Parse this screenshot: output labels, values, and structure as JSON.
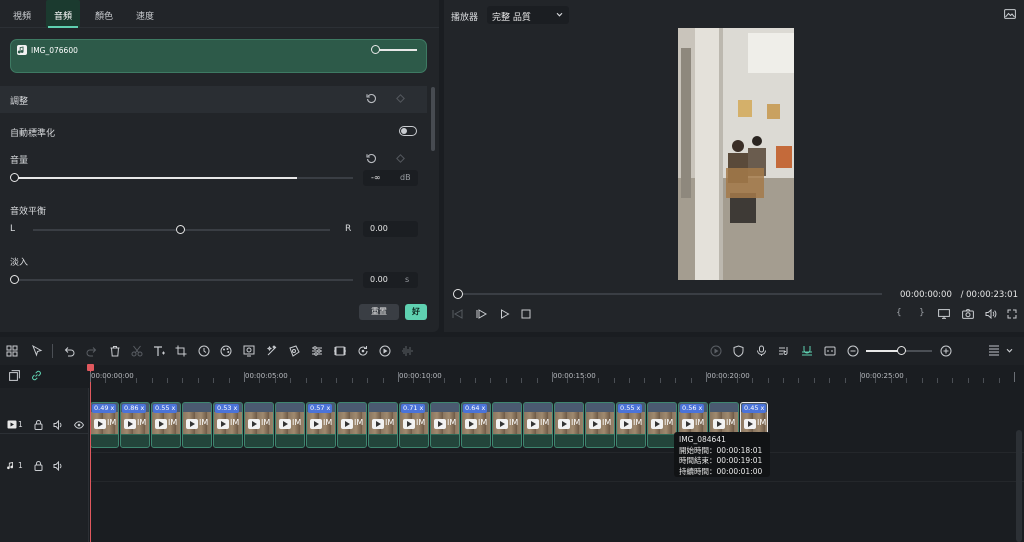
{
  "tabs": [
    "視頻",
    "音頻",
    "顏色",
    "速度"
  ],
  "active_tab": "音頻",
  "clip_name": "IMG_076600",
  "adjust_label": "調整",
  "auto_normalize_label": "自動標準化",
  "volume": {
    "label": "音量",
    "value": "-∞",
    "unit": "dB",
    "level": 0.0
  },
  "balance": {
    "label": "音效平衡",
    "left": "L",
    "right": "R",
    "value": "0.00"
  },
  "fade_in": {
    "label": "淡入",
    "value": "0.00",
    "unit": "s"
  },
  "buttons": {
    "reset": "重置",
    "ok": "好"
  },
  "player": {
    "label": "播放器",
    "quality": "完整 品質",
    "current_time": "00:00:00:00",
    "total_time": "/ 00:00:23:01"
  },
  "ruler": [
    "00:00:00:00",
    "00:00:05:00",
    "00:00:10:00",
    "00:00:15:00",
    "00:00:20:00",
    "00:00:25:00"
  ],
  "tracks": {
    "video": "1",
    "audio": "1"
  },
  "clips": [
    {
      "speed": "0.49 x",
      "text": "IM"
    },
    {
      "speed": "0.86 x",
      "text": "IM"
    },
    {
      "speed": "0.55 x",
      "text": "IM"
    },
    {
      "speed": "",
      "text": "IM"
    },
    {
      "speed": "0.53 x",
      "text": "IM"
    },
    {
      "speed": "",
      "text": "IM"
    },
    {
      "speed": "",
      "text": "IM"
    },
    {
      "speed": "0.57 x",
      "text": "IM"
    },
    {
      "speed": "",
      "text": "IM"
    },
    {
      "speed": "",
      "text": "IM"
    },
    {
      "speed": "0.71 x",
      "text": "IM"
    },
    {
      "speed": "",
      "text": "IM"
    },
    {
      "speed": "0.64 x",
      "text": "IM"
    },
    {
      "speed": "",
      "text": "IM"
    },
    {
      "speed": "",
      "text": "IM"
    },
    {
      "speed": "",
      "text": "IM"
    },
    {
      "speed": "",
      "text": "IM"
    },
    {
      "speed": "0.55 x",
      "text": "IM"
    },
    {
      "speed": "",
      "text": "IM"
    },
    {
      "speed": "0.56 x",
      "text": "IM"
    },
    {
      "speed": "",
      "text": "IM"
    },
    {
      "speed": "0.45 x",
      "text": "IM"
    }
  ],
  "tooltip": {
    "name": "IMG_084641",
    "start": "開始時間：00:00:18:01",
    "end": "時間結束：00:00:19:01",
    "duration": "持續時間：00:00:01:00"
  }
}
